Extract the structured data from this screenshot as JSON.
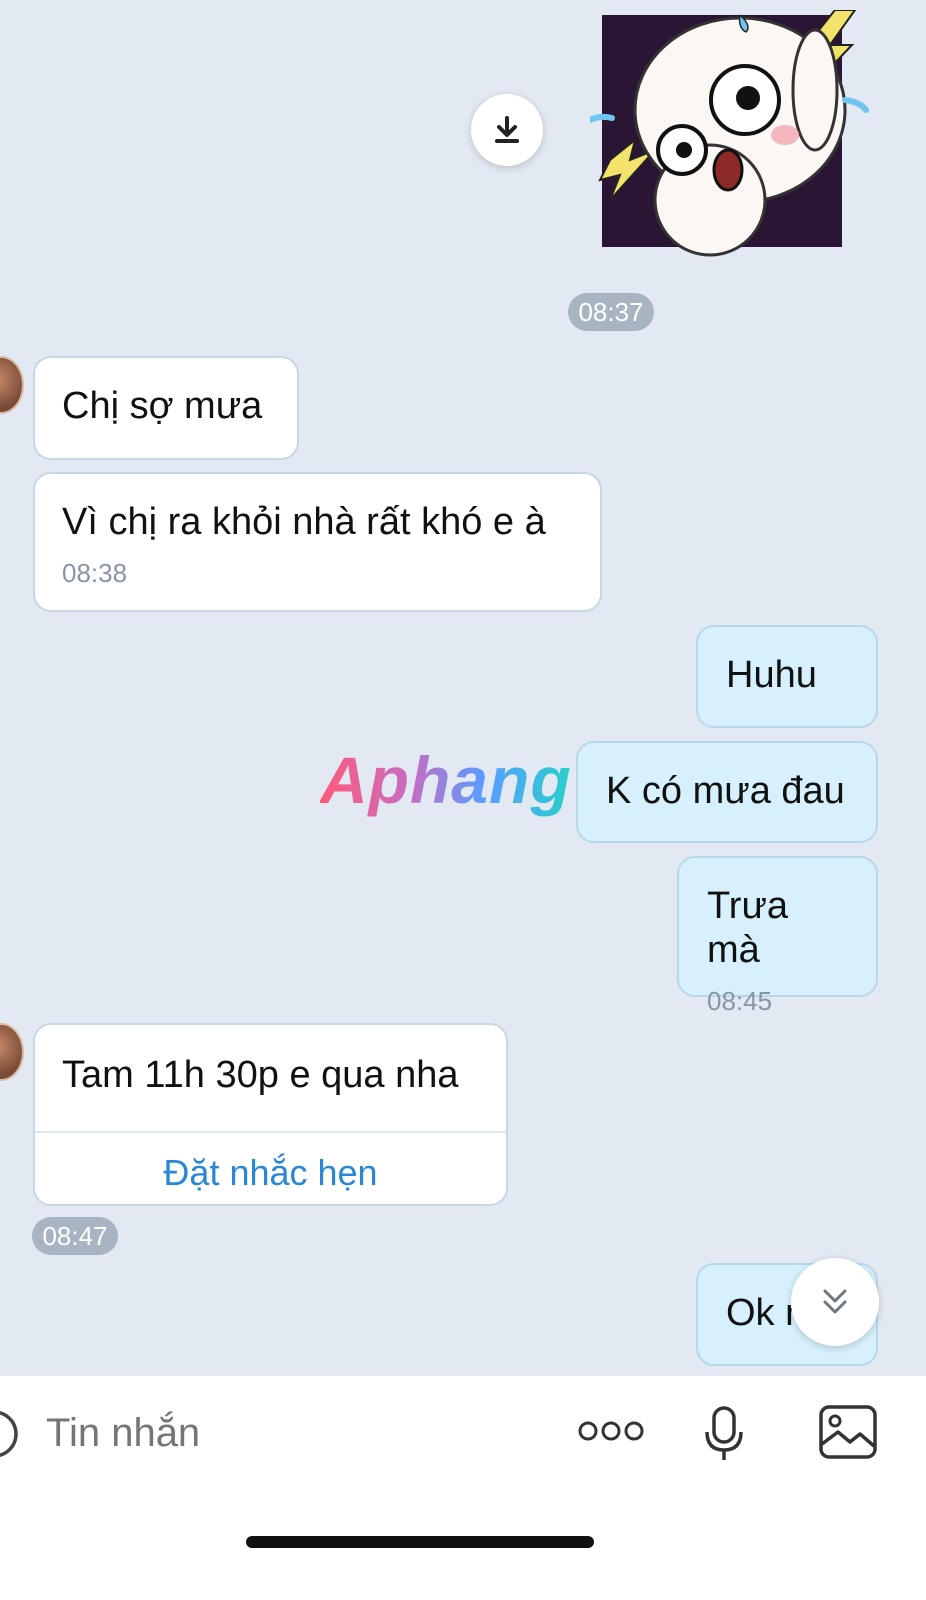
{
  "sticker_time": "08:37",
  "messages": [
    {
      "text": "Chị sợ mưa"
    },
    {
      "text": "Vì chị ra khỏi nhà rất khó e à",
      "time": "08:38"
    },
    {
      "text": "Huhu"
    },
    {
      "text": "K có mưa đau"
    },
    {
      "text": "Trưa mà",
      "time": "08:45"
    },
    {
      "text": "Tam 11h 30p e qua nha",
      "action": "Đặt nhắc hẹn",
      "time": "08:47"
    },
    {
      "text": "Ok n"
    }
  ],
  "watermark": "Aphang",
  "input": {
    "placeholder": "Tin nhắn"
  },
  "icons": {
    "download": "download-icon",
    "scroll_down": "chevron-double-down-icon",
    "more": "more-dots-icon",
    "mic": "microphone-icon",
    "image": "image-icon",
    "emoji": "emoji-icon"
  },
  "colors": {
    "background": "#e2e9f2",
    "incoming_bubble": "#ffffff",
    "outgoing_bubble": "#d6f0fd",
    "link": "#2a87d6"
  }
}
